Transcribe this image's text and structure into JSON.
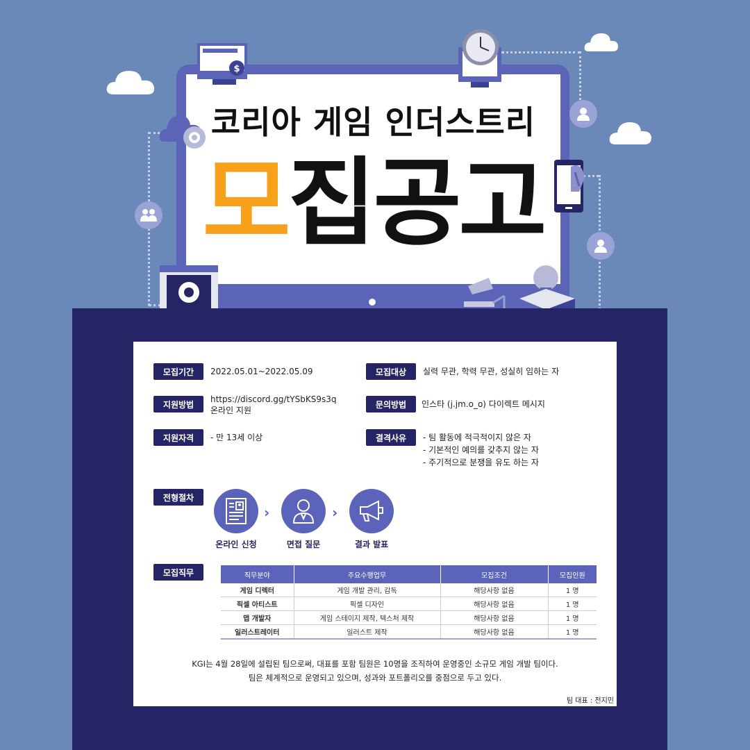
{
  "title_line": "코리아 게임 인더스트리",
  "title_big": [
    "모",
    "집",
    "공",
    "고"
  ],
  "colors": {
    "background": "#6b89b8",
    "navy": "#252566",
    "accent_purple": "#5b64ba",
    "orange": "#f7a11a"
  },
  "icons": [
    "cloud-icon",
    "gear-icon",
    "clock-icon",
    "person-icon",
    "group-icon",
    "smartphone-icon",
    "rocket-icon",
    "desk-lamp-icon",
    "books-icon",
    "lightbulb-icon",
    "box-icon",
    "resume-icon",
    "interviewer-icon",
    "megaphone-icon"
  ],
  "info": {
    "period": {
      "label": "모집기간",
      "value": "2022.05.01~2022.05.09"
    },
    "target": {
      "label": "모집대상",
      "value": "실력 무관, 학력 무관, 성실히 임하는 자"
    },
    "method": {
      "label": "지원방법",
      "line1": "https://discord.gg/tYSbKS9s3q",
      "line2": "온라인 지원"
    },
    "contact": {
      "label": "문의방법",
      "value": "인스타 (j.jm.o_o) 다이렉트 메시지"
    },
    "qualification": {
      "label": "지원자격",
      "value": "- 만 13세 이상"
    },
    "disqualification": {
      "label": "결격사유",
      "items": [
        "- 팀 활동에 적극적이지 않은 자",
        "- 기본적인 예의를 갖추지 않는 자",
        "- 주기적으로 분쟁을 유도 하는 자"
      ]
    }
  },
  "process": {
    "label": "전형절차",
    "steps": [
      "온라인 신청",
      "면접 질문",
      "결과 발표"
    ]
  },
  "jobs": {
    "label": "모집직무",
    "headers": [
      "직무분야",
      "주요수행업무",
      "모집조건",
      "모집인원"
    ],
    "rows": [
      [
        "게임 디렉터",
        "게임 개발 관리, 감독",
        "해당사항 없음",
        "1 명"
      ],
      [
        "픽셀 아티스트",
        "픽셀 디자인",
        "해당사항 없음",
        "1 명"
      ],
      [
        "맵 개발자",
        "게임 스테이지 제작, 텍스처 제작",
        "해당사항 없음",
        "1 명"
      ],
      [
        "일러스트레이터",
        "일러스트 제작",
        "해당사항 없음",
        "1 명"
      ]
    ]
  },
  "footer": {
    "line1": "KGI는 4월 28일에 설립된 팀으로써, 대표를 포함 팀원은 10명을 조직하여 운영중인 소규모 게임 개발 팀이다.",
    "line2": "팀은 체계적으로 운영되고 있으며, 성과와 포트폴리오를 중점으로 두고 있다.",
    "leader": "팀 대표 : 전지민"
  }
}
